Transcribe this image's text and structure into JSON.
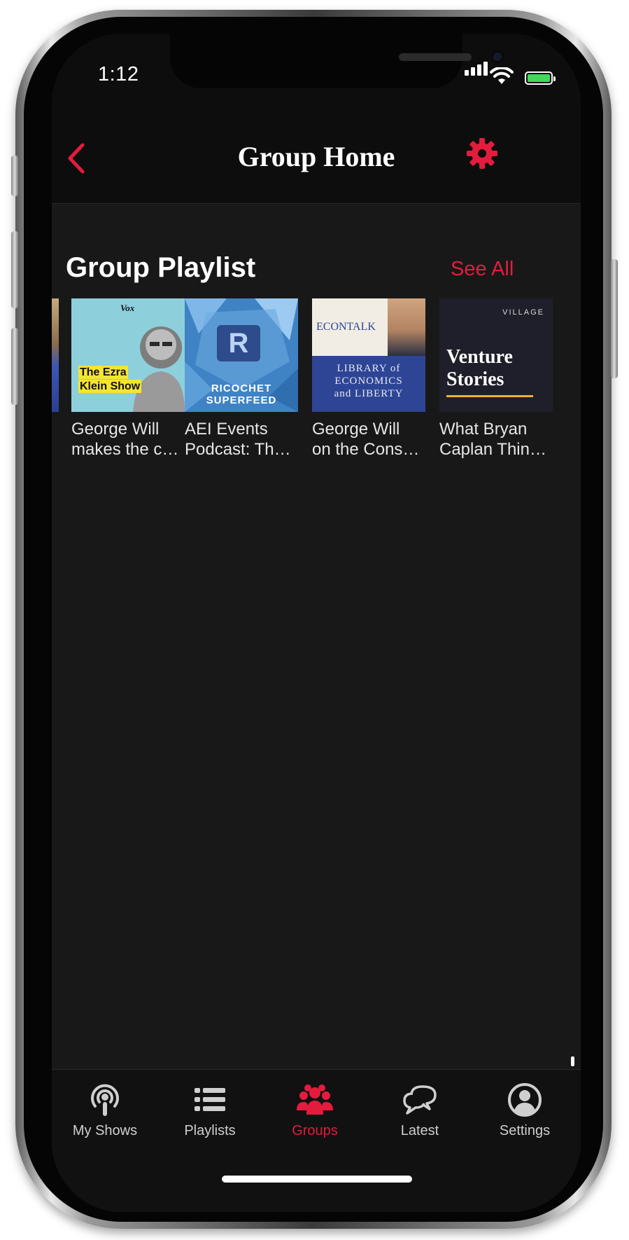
{
  "status_bar": {
    "time": "1:12"
  },
  "nav": {
    "title": "Group Home"
  },
  "playlist": {
    "title": "Group Playlist",
    "see_all": "See All",
    "items": [
      {
        "line1": "George Will",
        "line2": "makes the c…",
        "cover_lines": [
          "The Ezra",
          "Klein Show"
        ],
        "cover_badge": "Vox"
      },
      {
        "line1": "AEI Events",
        "line2": "Podcast: Th…",
        "cover_lines": [
          "RICOCHET",
          "SUPERFEED"
        ],
        "cover_badge": "R"
      },
      {
        "line1": "George Will",
        "line2": "on the Cons…",
        "cover_lines": [
          "LIBRARY of",
          "ECONOMICS",
          "and LIBERTY"
        ],
        "cover_badge": "ECONTALK"
      },
      {
        "line1": "What Bryan",
        "line2": "Caplan Thin…",
        "cover_lines": [
          "Venture",
          "Stories"
        ],
        "cover_badge": "VILLAGE"
      }
    ]
  },
  "tabs": [
    {
      "label": "My Shows",
      "icon": "podcast-icon",
      "active": false
    },
    {
      "label": "Playlists",
      "icon": "list-icon",
      "active": false
    },
    {
      "label": "Groups",
      "icon": "group-icon",
      "active": true
    },
    {
      "label": "Latest",
      "icon": "chat-bubbles-icon",
      "active": false
    },
    {
      "label": "Settings",
      "icon": "user-circle-icon",
      "active": false
    }
  ],
  "colors": {
    "accent": "#e31c3d",
    "background": "#181818",
    "bar": "#0d0d0d"
  }
}
